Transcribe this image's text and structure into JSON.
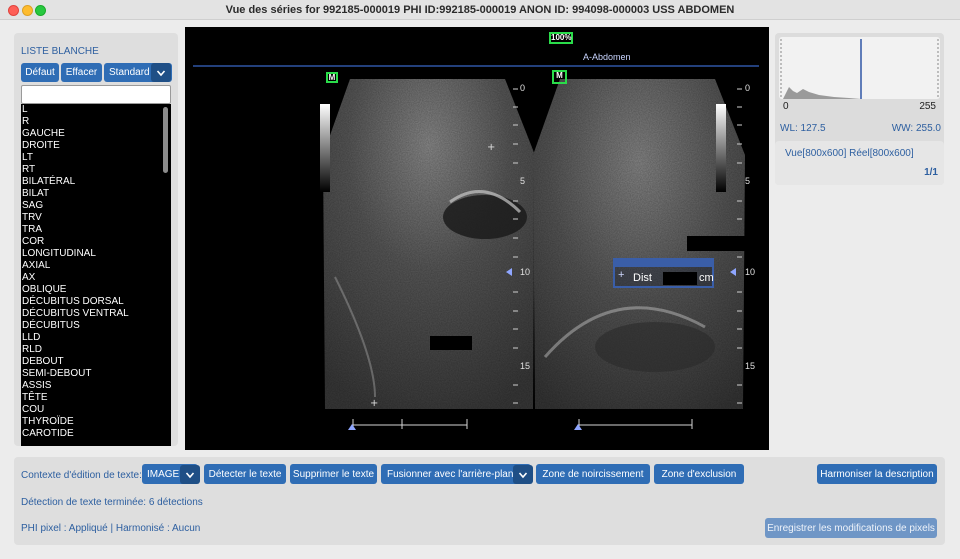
{
  "window": {
    "title": "Vue des séries for 992185-000019 PHI ID:992185-000019 ANON ID: 994098-000003 USS ABDOMEN"
  },
  "whitelist": {
    "title": "LISTE BLANCHE",
    "buttons": {
      "default": "Défaut",
      "clear": "Effacer",
      "preset": "Standard"
    },
    "filter_value": "",
    "items": [
      "L",
      "R",
      "GAUCHE",
      "DROITE",
      "LT",
      "RT",
      "BILATÉRAL",
      "BILAT",
      "SAG",
      "TRV",
      "TRA",
      "COR",
      "LONGITUDINAL",
      "AXIAL",
      "AX",
      "OBLIQUE",
      "DÉCUBITUS DORSAL",
      "DÉCUBITUS VENTRAL",
      "DÉCUBITUS",
      "LLD",
      "RLD",
      "DEBOUT",
      "SEMI-DEBOUT",
      "ASSIS",
      "TÊTE",
      "COU",
      "THYROÏDE",
      "CAROTIDE"
    ]
  },
  "viewer": {
    "zoom": "100%",
    "study_label": "A-Abdomen",
    "marker_letter": "M",
    "depth_labels": [
      "0",
      "5",
      "10",
      "15"
    ],
    "measure": {
      "label": "Dist",
      "unit": "cm"
    }
  },
  "side": {
    "hist_min": "0",
    "hist_max": "255",
    "wl": "WL: 127.5",
    "ww": "WW: 255.0",
    "view_size": "Vue[800x600] Réel[800x600]",
    "page": "1/1"
  },
  "bottom": {
    "context_label": "Contexte d'édition de texte:",
    "context_value": "IMAGE",
    "detect_btn": "Détecter le texte",
    "delete_btn": "Supprimer le texte",
    "merge_value": "Fusionner avec l'arrière-plan",
    "blackout_btn": "Zone de noircissement",
    "exclusion_btn": "Zone d'exclusion",
    "harmonize_btn": "Harmoniser la description",
    "detection_status": "Détection de texte terminée: 6 détections",
    "phi_status": "PHI pixel : Appliqué | Harmonisé : Aucun",
    "save_btn": "Enregistrer les modifications de pixels"
  },
  "colors": {
    "accent": "#2f6db5",
    "accent_dark": "#1f4f86",
    "label_blue": "#2d5fa0",
    "overlay_green": "#2adc4a"
  }
}
